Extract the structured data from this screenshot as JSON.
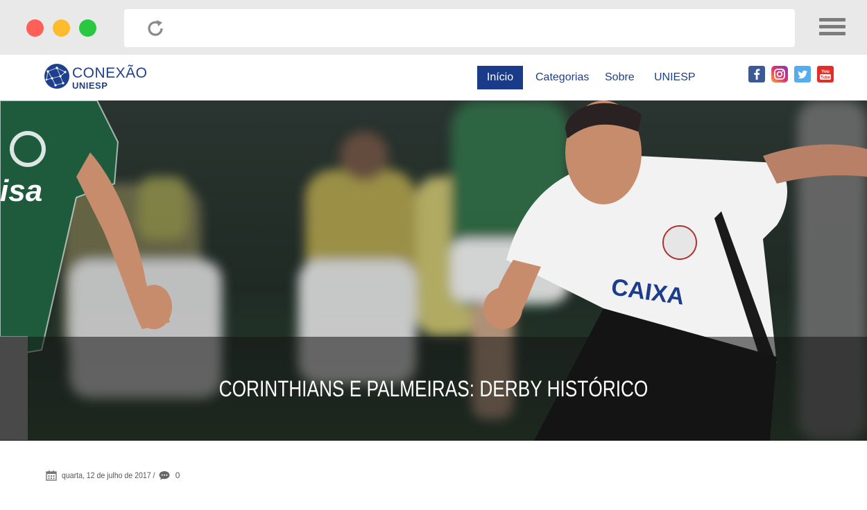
{
  "browser": {
    "window_controls": [
      "close",
      "minimize",
      "maximize"
    ],
    "reload_icon": "reload-icon",
    "menu_icon": "hamburger-menu-icon"
  },
  "site": {
    "logo": {
      "line1": "CONEXÃO",
      "line2": "UNIESP",
      "icon": "globe-network-icon"
    },
    "nav": [
      {
        "label": "Início",
        "active": true
      },
      {
        "label": "Categorias",
        "active": false
      },
      {
        "label": "Sobre",
        "active": false
      },
      {
        "label": "UNIESP",
        "active": false
      }
    ],
    "social": [
      {
        "name": "facebook-icon",
        "color": "#3b5998"
      },
      {
        "name": "instagram-icon",
        "color": "#c13584"
      },
      {
        "name": "twitter-icon",
        "color": "#55acee"
      },
      {
        "name": "youtube-icon",
        "color": "#e52d27"
      }
    ],
    "brand_color": "#1d3f8c"
  },
  "hero": {
    "title": "CORINTHIANS E PALMEIRAS: DERBY HISTÓRICO"
  },
  "post_meta": {
    "date": "quarta, 12 de julho de 2017 /",
    "comments": "0",
    "calendar_icon": "calendar-icon",
    "comment_icon": "comment-icon"
  }
}
